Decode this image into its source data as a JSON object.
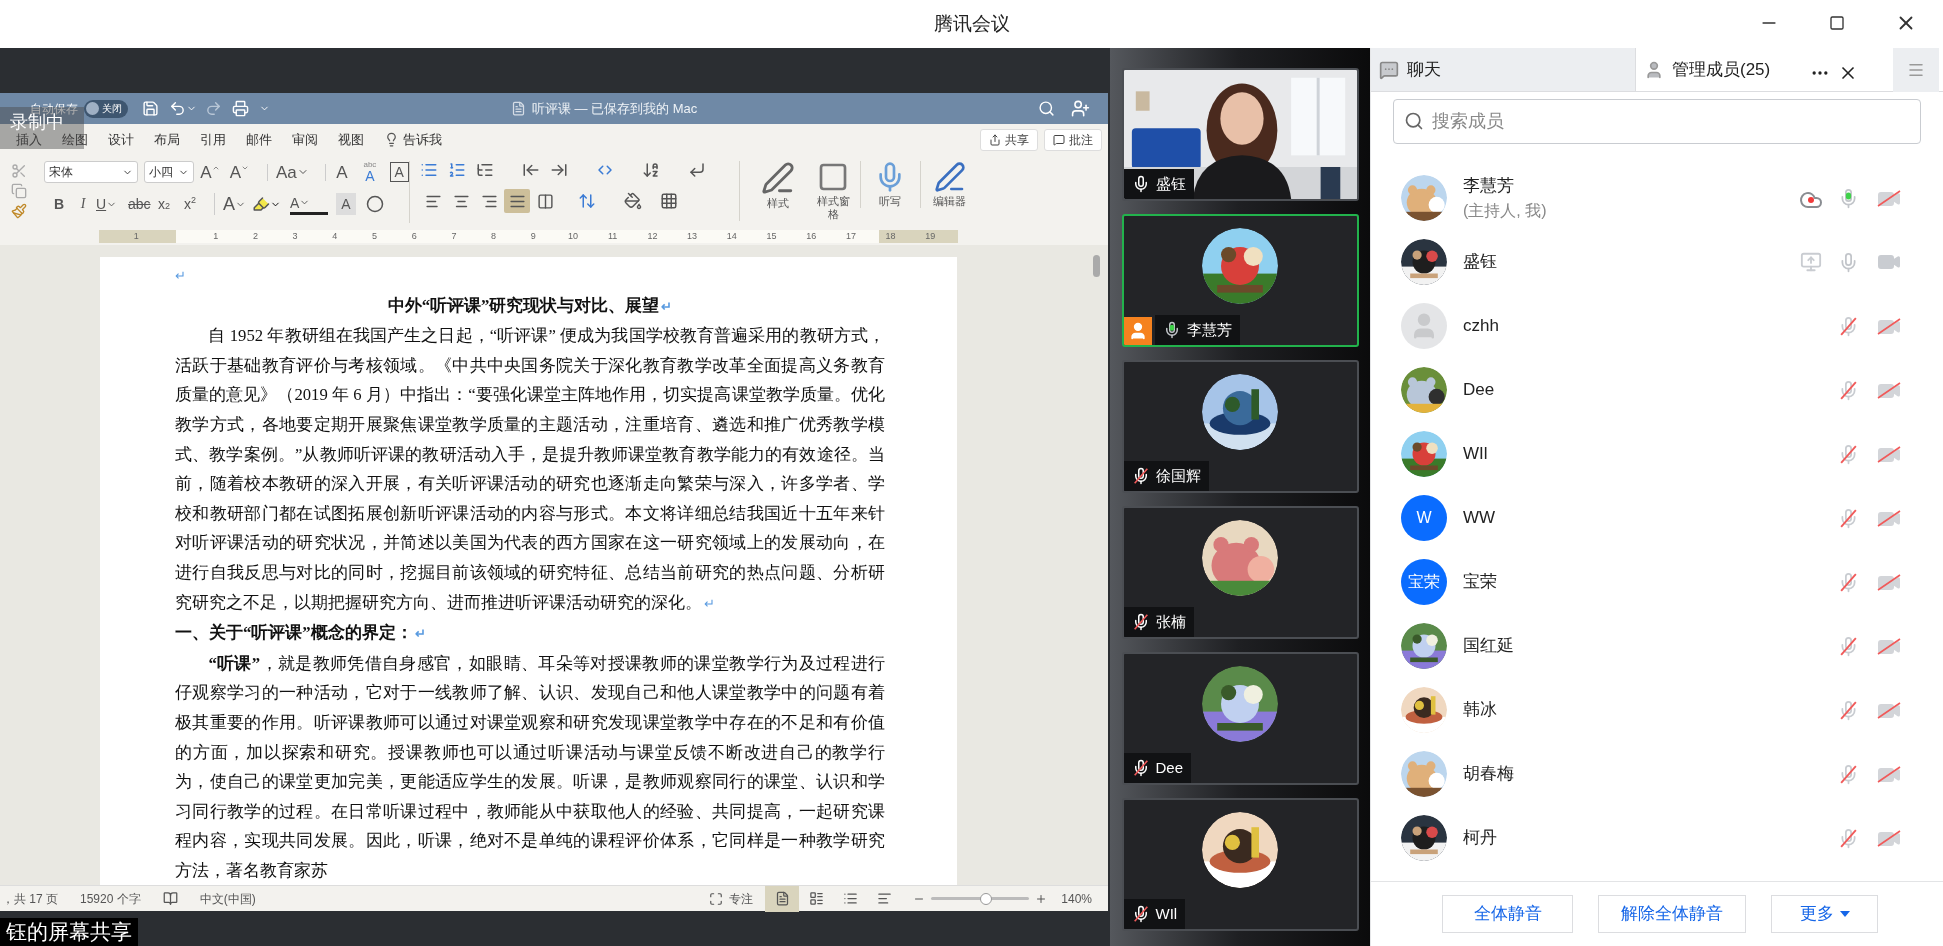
{
  "window": {
    "title": "腾讯会议"
  },
  "share": {
    "recording_label": "录制中",
    "caption": "钰的屏幕共享",
    "word": {
      "autosave": "自动保存",
      "autosave_toggle": "关闭",
      "doc_title": "听评课 — 已保存到我的 Mac",
      "tabs": [
        "插入",
        "绘图",
        "设计",
        "布局",
        "引用",
        "邮件",
        "审阅",
        "视图"
      ],
      "tell_me": "告诉我",
      "share_button": "共享",
      "comment_button": "批注",
      "font": "宋体",
      "size": "小四",
      "font_buttons": [
        {
          "kind": "grow",
          "label": "A"
        },
        {
          "kind": "shrink",
          "label": "A"
        },
        {
          "kind": "case",
          "label": "Aa"
        },
        {
          "kind": "clear",
          "label": "A"
        },
        {
          "kind": "phonetic",
          "label": "A",
          "small": "abc"
        },
        {
          "kind": "boxed",
          "label": "A"
        }
      ],
      "format_buttons": [
        {
          "kind": "bold",
          "label": "B"
        },
        {
          "kind": "italic",
          "label": "I"
        },
        {
          "kind": "underline",
          "label": "U"
        },
        {
          "kind": "strike",
          "label": "abc"
        },
        {
          "kind": "sub",
          "label": "x",
          "index": "2"
        },
        {
          "kind": "sup",
          "label": "x",
          "index": "2"
        },
        {
          "kind": "effect",
          "label": "A"
        },
        {
          "kind": "highlight"
        },
        {
          "kind": "color",
          "label": "A"
        },
        {
          "kind": "shade",
          "label": "A"
        },
        {
          "kind": "enclose"
        }
      ],
      "align_buttons": [
        {
          "kind": "left",
          "selected": false
        },
        {
          "kind": "center",
          "selected": false
        },
        {
          "kind": "right",
          "selected": false
        },
        {
          "kind": "justify",
          "selected": true
        },
        {
          "kind": "distributed",
          "selected": false
        }
      ],
      "big_buttons": [
        {
          "kind": "styles",
          "label": "样式"
        },
        {
          "kind": "pane",
          "label": "样式窗格"
        },
        {
          "kind": "dictate",
          "label": "听写"
        },
        {
          "kind": "editor",
          "label": "编辑器"
        }
      ],
      "ruler": [
        "1",
        "1",
        "2",
        "3",
        "4",
        "5",
        "6",
        "7",
        "8",
        "9",
        "10",
        "11",
        "12",
        "13",
        "14",
        "15",
        "16",
        "17",
        "18",
        "19"
      ],
      "paragraphs": [
        {
          "kind": "mark",
          "mark": "↵"
        },
        {
          "kind": "title",
          "text": "中外“听评课”研究现状与对比、展望",
          "mark": "↵"
        },
        {
          "kind": "body",
          "text": "自 1952 年教研组在我国产生之日起，“听评课” 便成为我国学校教育普遍采用的教研方式，活跃于基础教育评价与考核领域。《中共中央国务院关于深化教育教学改革全面提高义务教育质量的意见》（2019 年 6 月）中指出：“要强化课堂主阵地作用，切实提高课堂教学质量。优化教学方式，各地要定期开展聚焦课堂教学质量的主题活动，注重培育、遴选和推广优秀教学模式、教学案例。”从教师听评课的教研活动入手，是提升教师课堂教育教学能力的有效途径。当前，随着校本教研的深入开展，有关听评课活动的研究也逐渐走向繁荣与深入，许多学者、学校和教研部门都在试图拓展创新听评课活动的内容与形式。本文将详细总结我国近十五年来针对听评课活动的研究状况，并简述以美国为代表的西方国家在这一研究领域上的发展动向，在进行自我反思与对比的同时，挖掘目前该领域的研究特征、总结当前研究的热点问题、分析研究研究之不足，以期把握研究方向、进而推进听评课活动研究的深化。",
          "mark": "↵"
        },
        {
          "kind": "heading",
          "text": "一、关于“听评课”概念的界定：",
          "mark": "↵"
        },
        {
          "kind": "body",
          "text": "**“听课”**，就是教师凭借自身感官，如眼睛、耳朵等对授课教师的课堂教学行为及过程进行仔观察学习的一种活动，它对于一线教师了解、认识、发现自己和他人课堂教学中的问题有着极其重要的作用。听评课教师可以通过对课堂观察和研究发现课堂教学中存在的不足和有价值的方面，加以探索和研究。授课教师也可以通过听课活动与课堂反馈不断改进自己的教学行为，使自己的课堂更加完美，更能适应学生的发展。听课，是教师观察同行的课堂、认识和学习同行教学的过程。在日常听课过程中，教师能从中获取他人的经验、共同提高，一起研究课程内容，实现共同发展。因此，听课，绝对不是单纯的课程评价体系，它同样是一种教学研究方法，著名教育家苏"
        }
      ],
      "status": {
        "pages": "，共 17 页",
        "words": "15920 个字",
        "language": "中文(中国)",
        "focus": "专注",
        "views": [
          {
            "selected": true
          },
          {
            "selected": false
          },
          {
            "selected": false
          },
          {
            "selected": false
          }
        ],
        "zoom": {
          "level": 0.56
        },
        "zoom_label": "140%"
      }
    }
  },
  "tiles": [
    {
      "name": "盛钰",
      "kind": "camera",
      "muted": false,
      "speaking": false,
      "selected": false,
      "host": false
    },
    {
      "name": "李慧芳",
      "kind": "avatar",
      "muted": false,
      "speaking": true,
      "selected": true,
      "host": true
    },
    {
      "name": "徐国辉",
      "kind": "avatar",
      "muted": true,
      "selected": false,
      "host": false
    },
    {
      "name": "张楠",
      "kind": "avatar",
      "muted": true,
      "selected": false,
      "host": false
    },
    {
      "name": "Dee",
      "kind": "avatar",
      "muted": true,
      "selected": false,
      "host": false
    },
    {
      "name": "WIl",
      "kind": "avatar",
      "muted": true,
      "selected": false,
      "host": false
    }
  ],
  "panel": {
    "tabs": [
      {
        "label": "聊天",
        "selected": false
      },
      {
        "label": "管理成员(25)",
        "selected": true
      }
    ],
    "search": {
      "placeholder": "搜索成员"
    },
    "members": [
      {
        "name": "李慧芳",
        "note": "(主持人, 我)",
        "kind": "picture",
        "recording": true,
        "sharing": false,
        "muted": false,
        "speaking": true,
        "video_on": false
      },
      {
        "name": "盛钰",
        "kind": "picture",
        "recording": false,
        "sharing": true,
        "muted": false,
        "speaking": false,
        "video_on": true
      },
      {
        "name": "czhh",
        "kind": "default",
        "recording": false,
        "sharing": false,
        "muted": true,
        "video_on": false
      },
      {
        "name": "Dee",
        "kind": "picture",
        "recording": false,
        "sharing": false,
        "muted": true,
        "video_on": false
      },
      {
        "name": "WIl",
        "kind": "picture",
        "recording": false,
        "sharing": false,
        "muted": true,
        "video_on": false
      },
      {
        "name": "WW",
        "kind": "letter",
        "avatar_text": "W",
        "recording": false,
        "sharing": false,
        "muted": true,
        "video_on": false
      },
      {
        "name": "宝荣",
        "kind": "letter",
        "avatar_text": "宝荣",
        "recording": false,
        "sharing": false,
        "muted": true,
        "video_on": false
      },
      {
        "name": "国红延",
        "kind": "picture",
        "recording": false,
        "sharing": false,
        "muted": true,
        "video_on": false
      },
      {
        "name": "韩冰",
        "kind": "picture",
        "recording": false,
        "sharing": false,
        "muted": true,
        "video_on": false
      },
      {
        "name": "胡春梅",
        "kind": "picture",
        "recording": false,
        "sharing": false,
        "muted": true,
        "video_on": false
      },
      {
        "name": "柯丹",
        "kind": "picture",
        "recording": false,
        "sharing": false,
        "muted": true,
        "video_on": false
      }
    ],
    "buttons": [
      "全体静音",
      "解除全体静音"
    ],
    "more_button": "更多"
  }
}
